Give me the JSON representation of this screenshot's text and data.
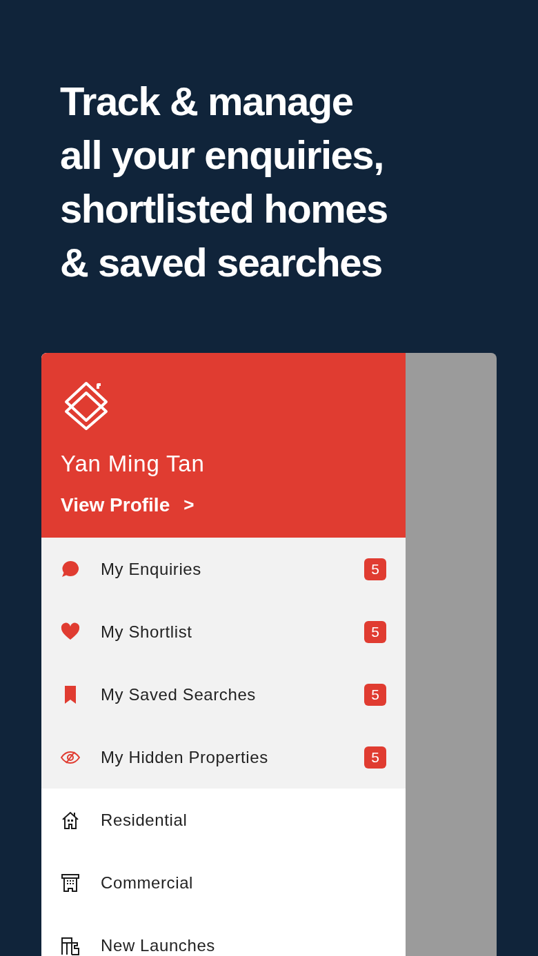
{
  "headline": "Track & manage\nall your enquiries,\nshortlisted homes\n& saved searches",
  "drawer": {
    "user_name": "Yan Ming Tan",
    "profile_link": "View Profile",
    "profile_chevron": ">",
    "items": [
      {
        "kind": "account",
        "label": "My Enquiries",
        "badge": "5"
      },
      {
        "kind": "account",
        "label": "My Shortlist",
        "badge": "5"
      },
      {
        "kind": "account",
        "label": "My Saved Searches",
        "badge": "5"
      },
      {
        "kind": "account",
        "label": "My Hidden Properties",
        "badge": "5"
      },
      {
        "kind": "category",
        "label": "Residential"
      },
      {
        "kind": "category",
        "label": "Commercial"
      },
      {
        "kind": "category",
        "label": "New Launches"
      }
    ]
  }
}
